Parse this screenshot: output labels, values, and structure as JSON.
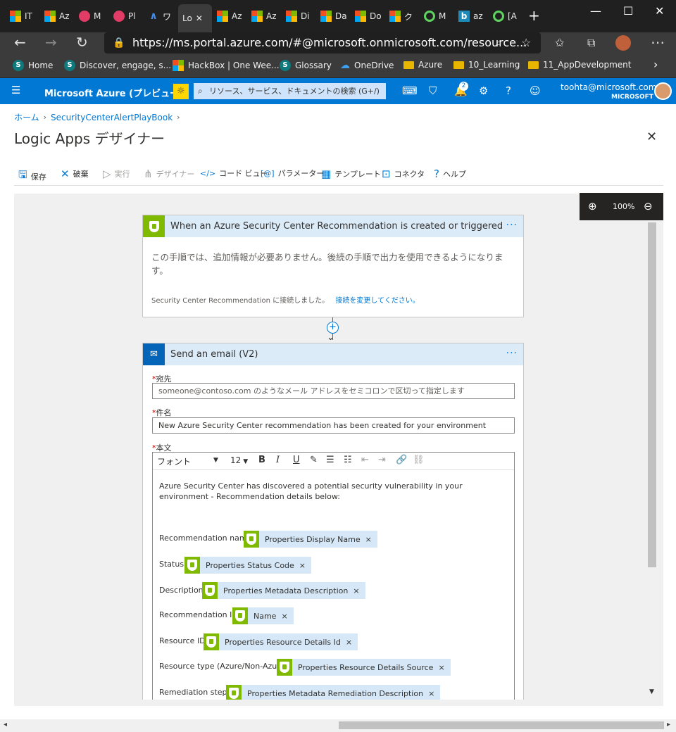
{
  "browser": {
    "tabs": [
      {
        "label": "IT",
        "icon": "ms-logo-icon"
      },
      {
        "label": "Az",
        "icon": "ms-logo-icon"
      },
      {
        "label": "M",
        "icon": "stream-icon"
      },
      {
        "label": "Pl",
        "icon": "stream-icon"
      },
      {
        "label": "ワ",
        "icon": "azure-icon"
      },
      {
        "label": "Lo",
        "icon": "",
        "active": true
      },
      {
        "label": "Az",
        "icon": "ms-logo-icon"
      },
      {
        "label": "Az",
        "icon": "ms-logo-icon"
      },
      {
        "label": "Di",
        "icon": "ms-logo-icon"
      },
      {
        "label": "Da",
        "icon": "ms-logo-icon"
      },
      {
        "label": "Do",
        "icon": "ms-logo-icon"
      },
      {
        "label": "ク",
        "icon": "ms-logo-icon"
      },
      {
        "label": "M",
        "icon": "green-circle-icon"
      },
      {
        "label": "az",
        "icon": "bing-icon"
      },
      {
        "label": "[A",
        "icon": "green-circle-icon"
      }
    ],
    "new_tab": "+",
    "url": "https://ms.portal.azure.com/#@microsoft.onmicrosoft.com/resource...",
    "url_host": "ms.portal.azure.com",
    "bookmarks": [
      "Home",
      "Discover, engage, s...",
      "HackBox | One Wee...",
      "Glossary",
      "OneDrive",
      "Azure",
      "10_Learning",
      "11_AppDevelopment"
    ]
  },
  "azure": {
    "brand": "Microsoft Azure (プレビュー)",
    "search_placeholder": "リソース、サービス、ドキュメントの検索 (G+/)",
    "notification_count": "2",
    "user_email": "toohta@microsoft.com",
    "user_org": "MICROSOFT"
  },
  "page": {
    "breadcrumb": [
      "ホーム",
      "SecurityCenterAlertPlayBook"
    ],
    "title": "Logic Apps デザイナー"
  },
  "toolbar": {
    "items": [
      {
        "label": "保存",
        "icon": "save-icon",
        "disabled": false
      },
      {
        "label": "破棄",
        "icon": "discard-icon",
        "disabled": false
      },
      {
        "label": "実行",
        "icon": "run-icon",
        "disabled": true
      },
      {
        "label": "デザイナー",
        "icon": "designer-icon",
        "disabled": true
      },
      {
        "label": "コード ビュー",
        "icon": "code-icon",
        "disabled": false
      },
      {
        "label": "パラメーター",
        "icon": "parameters-icon",
        "disabled": false
      },
      {
        "label": "テンプレート",
        "icon": "template-icon",
        "disabled": false
      },
      {
        "label": "コネクタ",
        "icon": "connector-icon",
        "disabled": false
      },
      {
        "label": "ヘルプ",
        "icon": "help-icon",
        "disabled": false
      }
    ]
  },
  "zoom": {
    "level": "100%"
  },
  "trigger": {
    "title": "When an Azure Security Center Recommendation is created or triggered",
    "body": "この手順では、追加情報が必要ありません。後続の手順で出力を使用できるようになります。",
    "connection_text": "Security Center Recommendation に接続しました。",
    "connection_link": "接続を変更してください。"
  },
  "action": {
    "title": "Send an email (V2)",
    "to_label": "宛先",
    "to_placeholder": "someone@contoso.com のようなメール アドレスをセミコロンで区切って指定します",
    "subject_label": "件名",
    "subject_value": "New Azure Security Center recommendation has been created for your environment",
    "body_label": "本文",
    "font_select": "フォント",
    "font_size": "12",
    "body_intro": "Azure Security Center has discovered a potential security vulnerability in your environment - Recommendation details below:",
    "rows": [
      {
        "label": "Recommendation name:",
        "token": "Properties Display Name"
      },
      {
        "label": "Status:",
        "token": "Properties Status Code"
      },
      {
        "label": "Description:",
        "token": "Properties Metadata Description"
      },
      {
        "label": "Recommendation ID:",
        "token": "Name"
      },
      {
        "label": "Resource ID:",
        "token": "Properties Resource Details Id"
      },
      {
        "label": "Resource type (Azure/Non-Azure):",
        "token": "Properties Resource Details Source"
      },
      {
        "label": "Remediation steps:",
        "token": "Properties Metadata Remediation Description"
      }
    ]
  },
  "colors": {
    "azure_blue": "#0078d4",
    "shield_green": "#7fba00",
    "card_header": "#dcebf8"
  }
}
